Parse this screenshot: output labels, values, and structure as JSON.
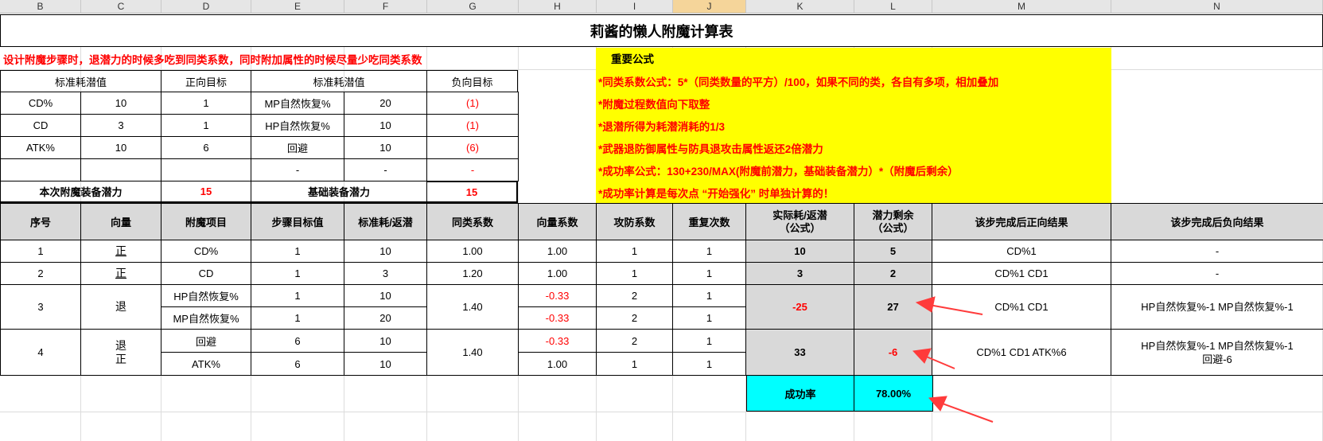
{
  "columns": [
    "B",
    "C",
    "D",
    "E",
    "F",
    "G",
    "H",
    "I",
    "J",
    "K",
    "L",
    "M",
    "N"
  ],
  "selected_column": "J",
  "title": "莉酱的懒人附魔计算表",
  "note": "设计附魔步骤时，退潜力的时候多吃到同类系数，同时附加属性的时候尽量少吃同类系数",
  "formulas": {
    "heading": "重要公式",
    "lines": [
      "*同类系数公式：5*（同类数量的平方）/100，如果不同的类，各自有多项，相加叠加",
      "*附魔过程数值向下取整",
      "*退潜所得为耗潜消耗的1/3",
      "*武器退防御属性与防具退攻击属性返还2倍潜力",
      "*成功率公式：130+230/MAX(附魔前潜力，基础装备潜力）*（附魔后剩余）",
      "*成功率计算是每次点 “开始强化” 时单独计算的！"
    ]
  },
  "cost_table": {
    "headers": [
      "标准耗潜值",
      "正向目标",
      "标准耗潜值",
      "负向目标"
    ],
    "rows": [
      [
        "CD%",
        "10",
        "1",
        "MP自然恢复%",
        "20",
        "(1)"
      ],
      [
        "CD",
        "3",
        "1",
        "HP自然恢复%",
        "10",
        "(1)"
      ],
      [
        "ATK%",
        "10",
        "6",
        "回避",
        "10",
        "(6)"
      ],
      [
        "",
        "",
        "",
        "-",
        "-",
        "-"
      ]
    ],
    "footer": {
      "label1": "本次附魔装备潜力",
      "value1": "15",
      "label2": "基础装备潜力",
      "value2": "15"
    }
  },
  "main_table": {
    "headers": [
      "序号",
      "向量",
      "附魔项目",
      "步骤目标值",
      "标准耗/返潜",
      "同类系数",
      "向量系数",
      "攻防系数",
      "重复次数",
      "实际耗/返潜\n（公式）",
      "潜力剩余\n（公式）",
      "该步完成后正向结果",
      "该步完成后负向结果"
    ],
    "steps": [
      {
        "no": "1",
        "vector": "正",
        "item": "CD%",
        "target": "1",
        "std": "10",
        "same": "1.00",
        "vec": "1.00",
        "atk": "1",
        "rep": "1",
        "actual": "10",
        "remain": "5",
        "pos": "CD%1",
        "neg": "-"
      },
      {
        "no": "2",
        "vector": "正",
        "item": "CD",
        "target": "1",
        "std": "3",
        "same": "1.20",
        "vec": "1.00",
        "atk": "1",
        "rep": "1",
        "actual": "3",
        "remain": "2",
        "pos": "CD%1 CD1",
        "neg": "-"
      },
      {
        "no": "3",
        "vector": "退",
        "same": "1.40",
        "actual": "-25",
        "remain": "27",
        "pos": "CD%1 CD1",
        "neg": "HP自然恢复%-1  MP自然恢复%-1",
        "sub": [
          {
            "item": "HP自然恢复%",
            "target": "1",
            "std": "10",
            "vec": "-0.33",
            "atk": "2",
            "rep": "1"
          },
          {
            "item": "MP自然恢复%",
            "target": "1",
            "std": "20",
            "vec": "-0.33",
            "atk": "2",
            "rep": "1"
          }
        ]
      },
      {
        "no": "4",
        "vector": "退\n正",
        "same": "1.40",
        "actual": "33",
        "remain": "-6",
        "pos": "CD%1 CD1 ATK%6",
        "neg": "HP自然恢复%-1  MP自然恢复%-1\n回避-6",
        "sub": [
          {
            "item": "回避",
            "target": "6",
            "std": "10",
            "vec": "-0.33",
            "atk": "2",
            "rep": "1"
          },
          {
            "item": "ATK%",
            "target": "6",
            "std": "10",
            "vec": "1.00",
            "atk": "1",
            "rep": "1"
          }
        ]
      }
    ],
    "success_label": "成功率",
    "success_value": "78.00%"
  },
  "colors": {
    "header_gray": "#d9d9d9",
    "formula_yellow": "#ffff00",
    "success_cyan": "#00ffff",
    "red": "#ff0000",
    "selected_col": "#f5d59a"
  }
}
